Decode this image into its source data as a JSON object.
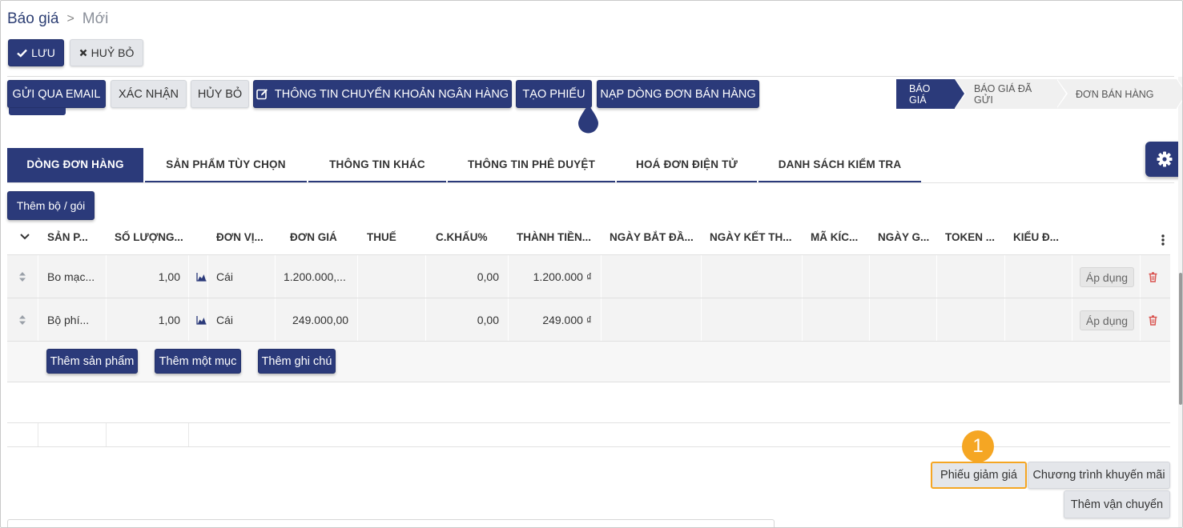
{
  "breadcrumb": {
    "root": "Báo giá",
    "separator": ">",
    "current": "Mới"
  },
  "toolbar": {
    "save_label": "LƯU",
    "discard_label": "HUỶ BỎ"
  },
  "status_buttons": {
    "send_email": "GỬI QUA EMAIL",
    "confirm": "XÁC NHẬN",
    "cancel": "HỦY BỎ",
    "bank_info": "THÔNG TIN CHUYỂN KHOẢN NGÂN HÀNG",
    "create_ticket": "TẠO PHIẾU",
    "load_sales_lines": "NẠP DÒNG ĐƠN BÁN HÀNG"
  },
  "stages": [
    "BÁO GIÁ",
    "BÁO GIÁ ĐÃ GỬI",
    "ĐƠN BÁN HÀNG"
  ],
  "active_stage": "BÁO GIÁ",
  "tabs": [
    "DÒNG ĐƠN HÀNG",
    "SẢN PHẨM TÙY CHỌN",
    "THÔNG TIN KHÁC",
    "THÔNG TIN PHÊ DUYỆT",
    "HOÁ ĐƠN ĐIỆN TỬ",
    "DANH SÁCH KIỂM TRA"
  ],
  "add_bundle_label": "Thêm bộ / gói",
  "table": {
    "columns": [
      "SẢN P...",
      "SỐ LƯỢNG...",
      "ĐƠN VỊ...",
      "ĐƠN GIÁ",
      "THUẾ",
      "C.KHẤU%",
      "THÀNH TIỀN...",
      "NGÀY BẮT ĐẦ...",
      "NGÀY KẾT TH...",
      "MÃ KÍC...",
      "NGÀY G...",
      "TOKEN ...",
      "KIỂU Đ..."
    ],
    "rows": [
      {
        "product": "Bo mạc...",
        "qty": "1,00",
        "uom": "Cái",
        "price": "1.200.000,...",
        "discount": "0,00",
        "subtotal": "1.200.000 ₫",
        "apply": "Áp dụng"
      },
      {
        "product": "Bộ phí...",
        "qty": "1,00",
        "uom": "Cái",
        "price": "249.000,00",
        "discount": "0,00",
        "subtotal": "249.000 ₫",
        "apply": "Áp dụng"
      }
    ],
    "add_product": "Thêm sản phẩm",
    "add_section": "Thêm một mục",
    "add_note": "Thêm ghi chú"
  },
  "actions": {
    "step_badge": "1",
    "coupon": "Phiếu giảm giá",
    "promotion": "Chương trình khuyến mãi",
    "shipping": "Thêm vận chuyển"
  },
  "colors": {
    "primary": "#2b3a7a",
    "highlight": "#f5a623",
    "delete": "#d9534f"
  },
  "icons": [
    "check-icon",
    "close-icon",
    "edit-icon",
    "gear-icon",
    "sort-handle-icon",
    "chart-icon",
    "trash-icon",
    "kebab-icon",
    "chevron-down-icon"
  ]
}
